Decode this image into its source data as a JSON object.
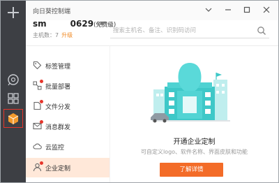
{
  "window": {
    "title": "向日葵控制端"
  },
  "account": {
    "name": "sm",
    "name_suffix": "0629",
    "tier": "(免费级)",
    "host_count": "主机数：7",
    "upgrade": "升级"
  },
  "search": {
    "placeholder": "搜索主机名、备注、识别码访问"
  },
  "menu": {
    "items": [
      {
        "label": "标签管理",
        "icon": "tag-icon",
        "dot": false
      },
      {
        "label": "批量部署",
        "icon": "deploy-icon",
        "dot": true
      },
      {
        "label": "文件分发",
        "icon": "file-share-icon",
        "dot": true
      },
      {
        "label": "消息群发",
        "icon": "message-icon",
        "dot": true
      },
      {
        "label": "云监控",
        "icon": "cloud-icon",
        "dot": false
      },
      {
        "label": "企业定制",
        "icon": "user-icon",
        "dot": true
      }
    ],
    "active_index": 5
  },
  "main": {
    "title": "开通企业定制",
    "subtitle": "可自定义logo、软件名称、界面皮肤和功能",
    "button": "了解详情"
  },
  "colors": {
    "accent": "#f36c28",
    "rail": "#3d3f44",
    "active_bg": "#ffe8d9",
    "alert": "#e6352b",
    "illustration": "#3ec8c8"
  }
}
